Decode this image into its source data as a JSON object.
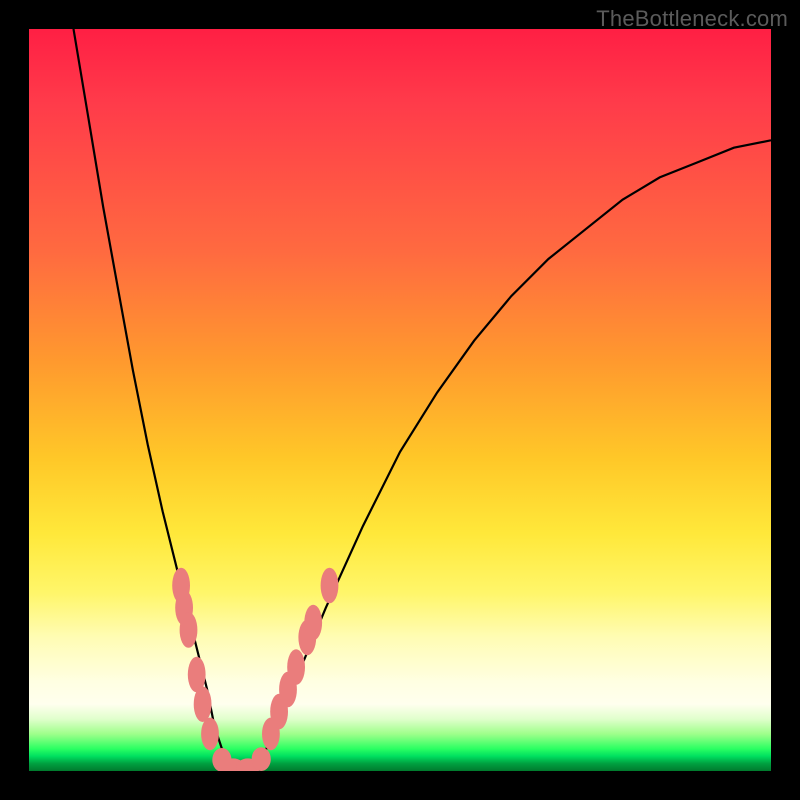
{
  "attribution": "TheBottleneck.com",
  "chart_data": {
    "type": "line",
    "title": "",
    "xlabel": "",
    "ylabel": "",
    "xlim": [
      0,
      100
    ],
    "ylim": [
      0,
      100
    ],
    "grid": false,
    "series": [
      {
        "name": "bottleneck-curve",
        "x": [
          6,
          8,
          10,
          12,
          14,
          16,
          18,
          20,
          22,
          24,
          25,
          26,
          28,
          30,
          32,
          35,
          40,
          45,
          50,
          55,
          60,
          65,
          70,
          75,
          80,
          85,
          90,
          95,
          100
        ],
        "y": [
          100,
          88,
          76,
          65,
          54,
          44,
          35,
          27,
          19,
          11,
          6,
          3,
          0,
          0,
          3,
          10,
          22,
          33,
          43,
          51,
          58,
          64,
          69,
          73,
          77,
          80,
          82,
          84,
          85
        ]
      }
    ],
    "markers": [
      {
        "x": 20.5,
        "y": 25,
        "rx": 1.2,
        "ry": 2.4
      },
      {
        "x": 20.9,
        "y": 22,
        "rx": 1.2,
        "ry": 2.4
      },
      {
        "x": 21.5,
        "y": 19,
        "rx": 1.2,
        "ry": 2.4
      },
      {
        "x": 22.6,
        "y": 13,
        "rx": 1.2,
        "ry": 2.4
      },
      {
        "x": 23.4,
        "y": 9,
        "rx": 1.2,
        "ry": 2.4
      },
      {
        "x": 24.4,
        "y": 5,
        "rx": 1.2,
        "ry": 2.2
      },
      {
        "x": 26.0,
        "y": 1.5,
        "rx": 1.3,
        "ry": 1.6
      },
      {
        "x": 27.5,
        "y": 0.5,
        "rx": 1.6,
        "ry": 1.2
      },
      {
        "x": 29.5,
        "y": 0.5,
        "rx": 1.6,
        "ry": 1.2
      },
      {
        "x": 31.3,
        "y": 1.6,
        "rx": 1.3,
        "ry": 1.6
      },
      {
        "x": 32.6,
        "y": 5,
        "rx": 1.2,
        "ry": 2.2
      },
      {
        "x": 33.7,
        "y": 8,
        "rx": 1.2,
        "ry": 2.4
      },
      {
        "x": 34.9,
        "y": 11,
        "rx": 1.2,
        "ry": 2.4
      },
      {
        "x": 36.0,
        "y": 14,
        "rx": 1.2,
        "ry": 2.4
      },
      {
        "x": 37.5,
        "y": 18,
        "rx": 1.2,
        "ry": 2.4
      },
      {
        "x": 38.3,
        "y": 20,
        "rx": 1.2,
        "ry": 2.4
      },
      {
        "x": 40.5,
        "y": 25,
        "rx": 1.2,
        "ry": 2.4
      }
    ],
    "colors": {
      "curve": "#000000",
      "marker": "#ea7d7c",
      "gradient_top": "#ff1f44",
      "gradient_mid": "#ffe83a",
      "gradient_bottom": "#007a2d"
    }
  }
}
